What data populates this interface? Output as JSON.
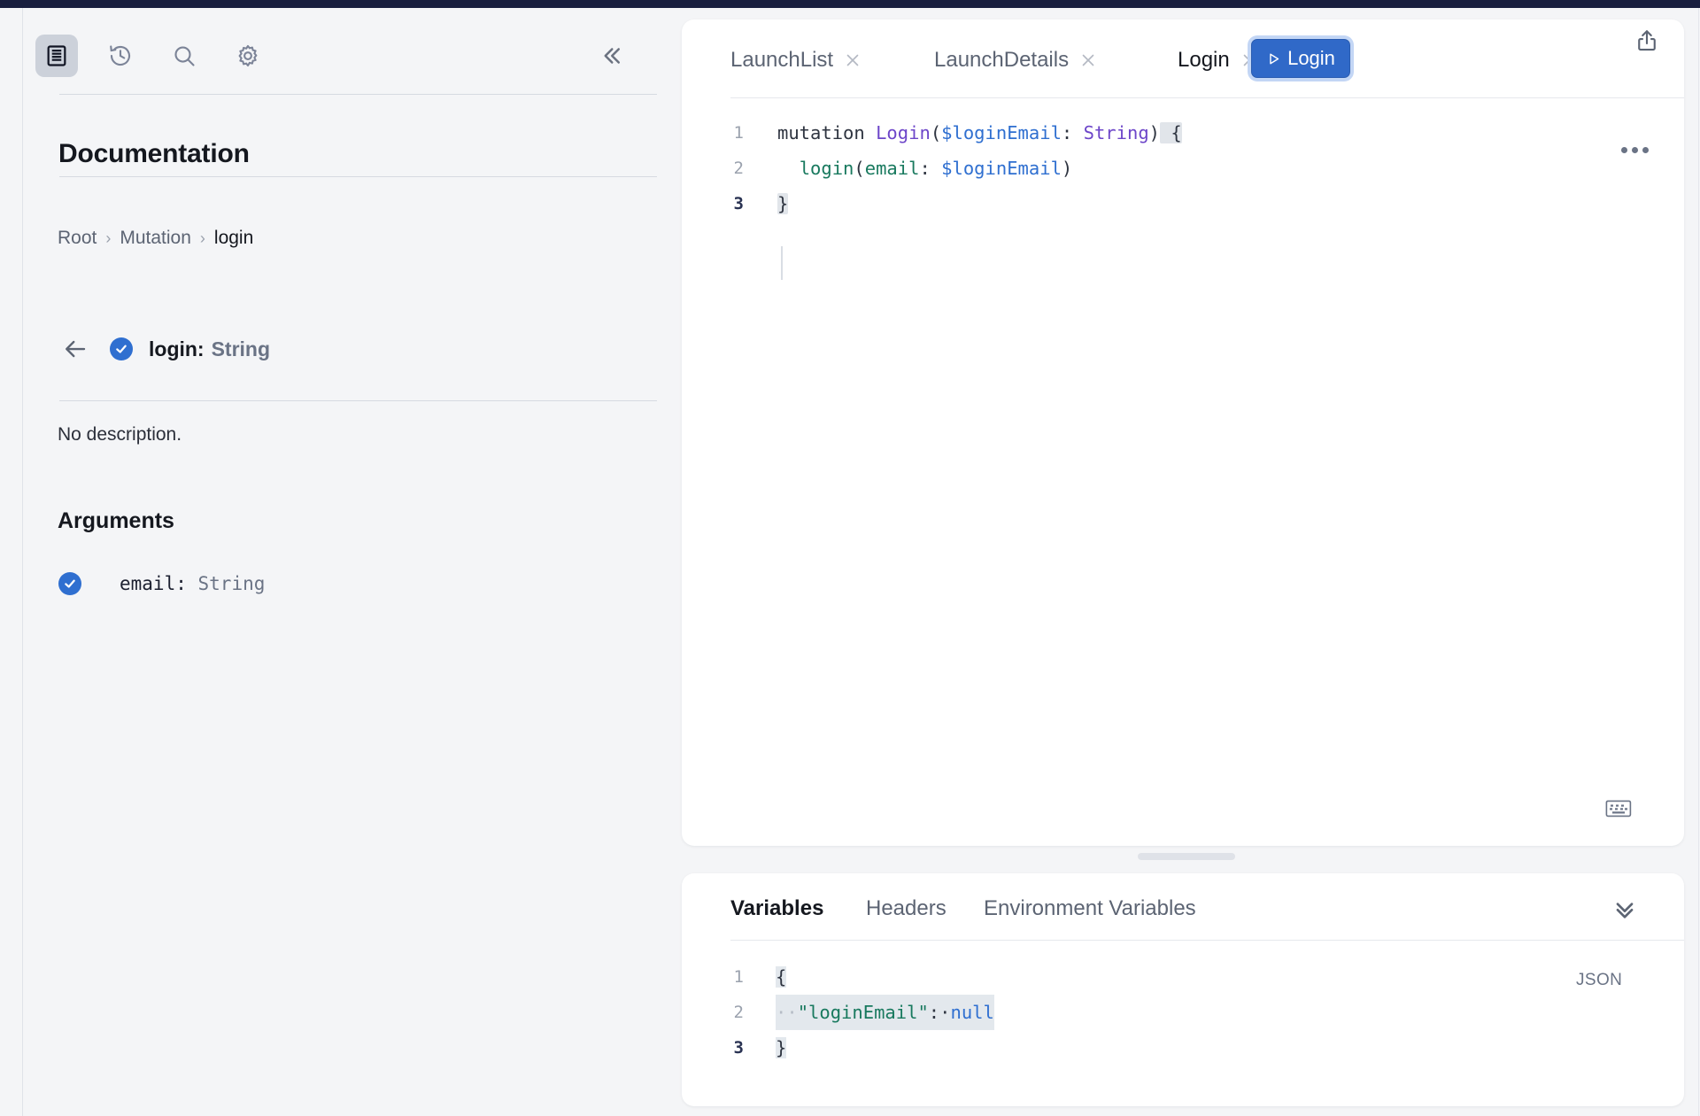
{
  "window": {
    "accent_navy": "#191f3f"
  },
  "sidebar": {
    "tools": [
      {
        "name": "documentation",
        "icon": "docs-icon",
        "active": true
      },
      {
        "name": "history",
        "icon": "history-icon",
        "active": false
      },
      {
        "name": "search",
        "icon": "search-icon",
        "active": false
      },
      {
        "name": "settings",
        "icon": "gear-icon",
        "active": false
      }
    ],
    "collapse_icon": "chevron-double-left-icon",
    "title": "Documentation",
    "breadcrumb": [
      {
        "label": "Root"
      },
      {
        "label": "Mutation"
      },
      {
        "label": "login"
      }
    ],
    "breadcrumb_separator": "›",
    "entry": {
      "back_icon": "arrow-left-icon",
      "dot_icon": "check-circle-icon",
      "name": "login:",
      "type": "String"
    },
    "description": "No description.",
    "arguments_title": "Arguments",
    "arguments": [
      {
        "dot_icon": "check-circle-icon",
        "name": "email:",
        "type": "String"
      }
    ]
  },
  "editor": {
    "tabs": [
      {
        "label": "LaunchList",
        "active": false,
        "close_icon": "close-icon"
      },
      {
        "label": "LaunchDetails",
        "active": false,
        "close_icon": "close-icon"
      },
      {
        "label": "Login",
        "active": true,
        "close_icon": "close-icon"
      }
    ],
    "add_tab_icon": "plus-icon",
    "share_icon": "share-icon",
    "run_button": {
      "label": "Login",
      "icon": "play-icon",
      "color": "#3069c8"
    },
    "more_icon": "ellipsis-icon",
    "keyboard_icon": "keyboard-icon",
    "line_numbers": [
      "1",
      "2",
      "3"
    ],
    "current_line": 3,
    "code": {
      "line1": {
        "kw": "mutation ",
        "op_name": "Login",
        "paren_open": "(",
        "var": "$loginEmail",
        "colon": ": ",
        "type": "String",
        "paren_close": ")",
        "brace": " {"
      },
      "line2": {
        "indent": "  ",
        "field": "login",
        "paren_open": "(",
        "arg": "email",
        "colon": ": ",
        "var": "$loginEmail",
        "paren_close": ")"
      },
      "line3": {
        "brace": "}"
      }
    }
  },
  "variables_panel": {
    "tabs": [
      {
        "label": "Variables",
        "active": true
      },
      {
        "label": "Headers",
        "active": false
      },
      {
        "label": "Environment Variables",
        "active": false
      }
    ],
    "collapse_icon": "chevron-double-down-icon",
    "format_label": "JSON",
    "line_numbers": [
      "1",
      "2",
      "3"
    ],
    "current_line": 3,
    "json": {
      "line1": "{",
      "line2_indent": "··",
      "line2_key": "\"loginEmail\"",
      "line2_colon": ":·",
      "line2_value": "null",
      "line3": "}"
    }
  }
}
